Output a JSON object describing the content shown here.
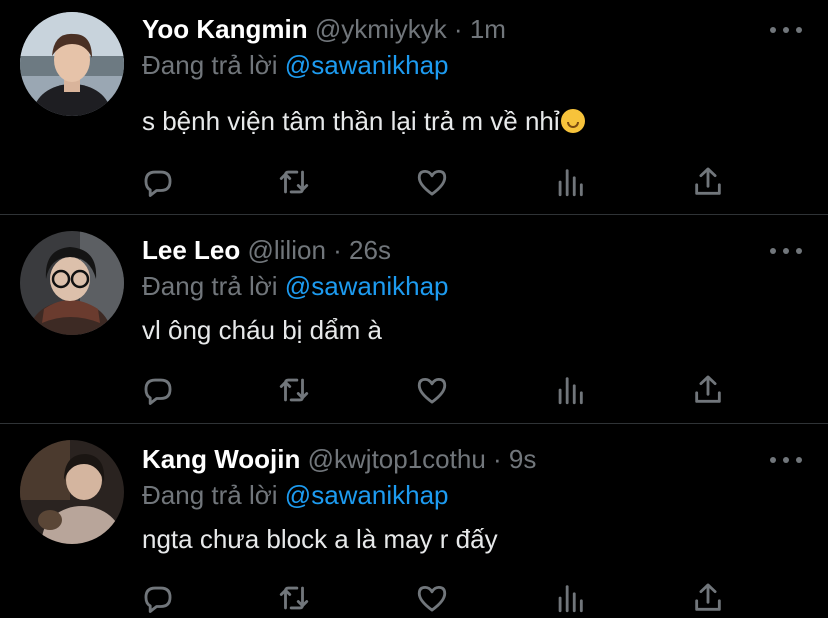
{
  "tweets": [
    {
      "name": "Yoo Kangmin",
      "handle": "@ykmiykyk",
      "dot": "·",
      "time": "1m",
      "reply_prefix": "Đang trả lời",
      "mention": "@sawanikhap",
      "text": "s bệnh viện tâm thần lại trả m về nhỉ",
      "emoji": "upside-down-face-emoji"
    },
    {
      "name": "Lee Leo",
      "handle": "@lilion",
      "dot": "·",
      "time": "26s",
      "reply_prefix": "Đang trả lời",
      "mention": "@sawanikhap",
      "text": "vl ông cháu bị dẩm à"
    },
    {
      "name": "Kang Woojin",
      "handle": "@kwjtop1cothu",
      "dot": "·",
      "time": "9s",
      "reply_prefix": "Đang trả lời",
      "mention": "@sawanikhap",
      "text": "ngta chưa block a là may r đấy"
    }
  ],
  "icons": [
    "reply-icon",
    "retweet-icon",
    "like-icon",
    "analytics-icon",
    "share-icon",
    "more-options-icon"
  ],
  "colors": {
    "background": "#000000",
    "secondary": "#71767b",
    "mention": "#1d9bf0",
    "divider": "#2f3336"
  }
}
